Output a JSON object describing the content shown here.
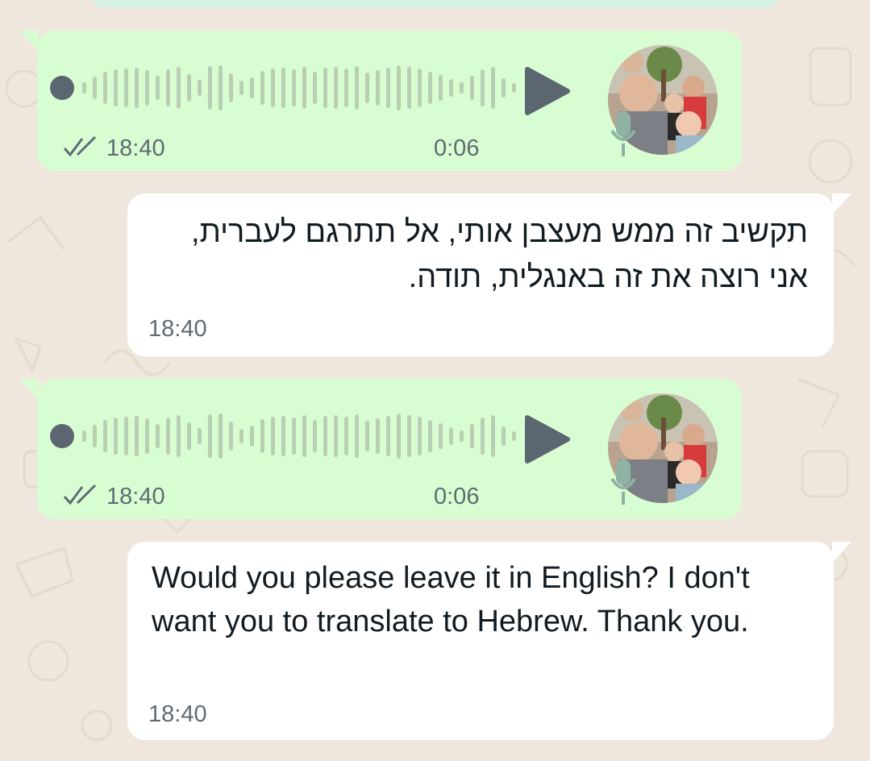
{
  "colors": {
    "wallpaper": "#efe7de",
    "outgoing_bubble": "#d9fdd3",
    "incoming_bubble": "#ffffff",
    "waveform": "#b8cfb2",
    "play_icon": "#5b6670",
    "meta_text": "#5f6b72"
  },
  "messages": [
    {
      "type": "voice",
      "direction": "outgoing",
      "time": "18:40",
      "duration": "0:06",
      "status": "read-double-check"
    },
    {
      "type": "text",
      "direction": "incoming",
      "text": "תקשיב זה ממש מעצבן אותי, אל תתרגם לעברית, אני רוצה את זה באנגלית, תודה.",
      "time": "18:40"
    },
    {
      "type": "voice",
      "direction": "outgoing",
      "time": "18:40",
      "duration": "0:06",
      "status": "read-double-check"
    },
    {
      "type": "text",
      "direction": "incoming",
      "text": "Would you please leave it in English? I don't want you to translate to Hebrew. Thank you.",
      "time": "18:40"
    }
  ]
}
